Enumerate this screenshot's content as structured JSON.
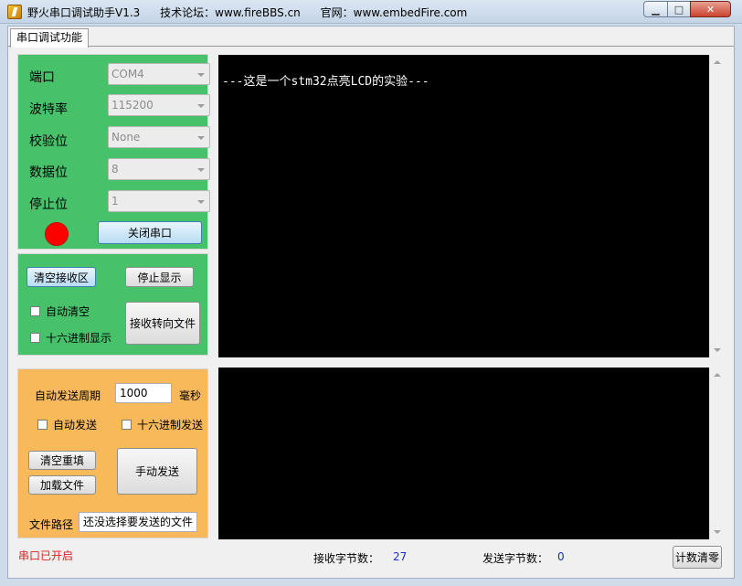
{
  "window": {
    "title": "野火串口调试助手V1.3",
    "forum": "技术论坛：www.fireBBS.cn",
    "website": "官网：www.embedFire.com",
    "min_label": "▁",
    "max_label": "□",
    "close_label": "✕"
  },
  "tab": {
    "label": "串口调试功能"
  },
  "serial": {
    "port_label": "端口",
    "port_value": "COM4",
    "baud_label": "波特率",
    "baud_value": "115200",
    "parity_label": "校验位",
    "parity_value": "None",
    "databits_label": "数据位",
    "databits_value": "8",
    "stopbits_label": "停止位",
    "stopbits_value": "1",
    "close_button": "关闭串口",
    "led_color": "#ff0000"
  },
  "receive": {
    "clear_button": "清空接收区",
    "stop_button": "停止显示",
    "auto_clear": "自动清空",
    "hex_display": "十六进制显示",
    "to_file_button": "接收转向文件"
  },
  "send": {
    "period_label": "自动发送周期",
    "period_value": "1000",
    "unit": "毫秒",
    "auto_send": "自动发送",
    "hex_send": "十六进制发送",
    "clear_button": "清空重填",
    "load_button": "加载文件",
    "manual_button": "手动发送",
    "path_label": "文件路径",
    "path_value": "还没选择要发送的文件"
  },
  "console": {
    "text": "---这是一个stm32点亮LCD的实验---"
  },
  "status": {
    "port_status": "串口已开启",
    "rx_label": "接收字节数：",
    "rx_value": "27",
    "tx_label": "发送字节数：",
    "tx_value": "0",
    "clear_count_button": "计数清零"
  },
  "colors": {
    "green_panel": "#47c26b",
    "orange_panel": "#f7b95a",
    "console_bg": "#000000"
  }
}
